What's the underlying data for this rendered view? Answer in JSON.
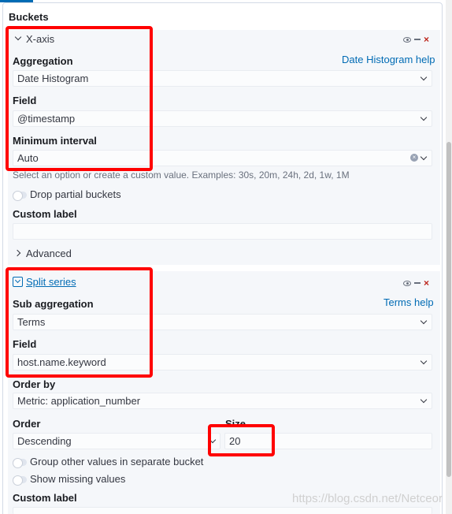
{
  "buckets": {
    "title": "Buckets"
  },
  "xaxis": {
    "header": "X-axis",
    "aggregation_label": "Aggregation",
    "help_link": "Date Histogram help",
    "aggregation_value": "Date Histogram",
    "field_label": "Field",
    "field_value": "@timestamp",
    "interval_label": "Minimum interval",
    "interval_value": "Auto",
    "interval_help": "Select an option or create a custom value. Examples: 30s, 20m, 24h, 2d, 1w, 1M",
    "drop_partial": "Drop partial buckets",
    "custom_label": "Custom label",
    "advanced": "Advanced"
  },
  "split": {
    "header": "Split series",
    "sub_agg_label": "Sub aggregation",
    "help_link": "Terms help",
    "sub_agg_value": "Terms",
    "field_label": "Field",
    "field_value": "host.name.keyword",
    "order_by_label": "Order by",
    "order_by_value": "Metric: application_number",
    "order_label": "Order",
    "order_value": "Descending",
    "size_label": "Size",
    "size_value": "20",
    "group_other": "Group other values in separate bucket",
    "show_missing": "Show missing values",
    "custom_label": "Custom label"
  },
  "watermark": "https://blog.csdn.net/Netceor",
  "colors": {
    "accent": "#006bb4",
    "danger": "#bd271e",
    "annotation": "#ff0000"
  }
}
